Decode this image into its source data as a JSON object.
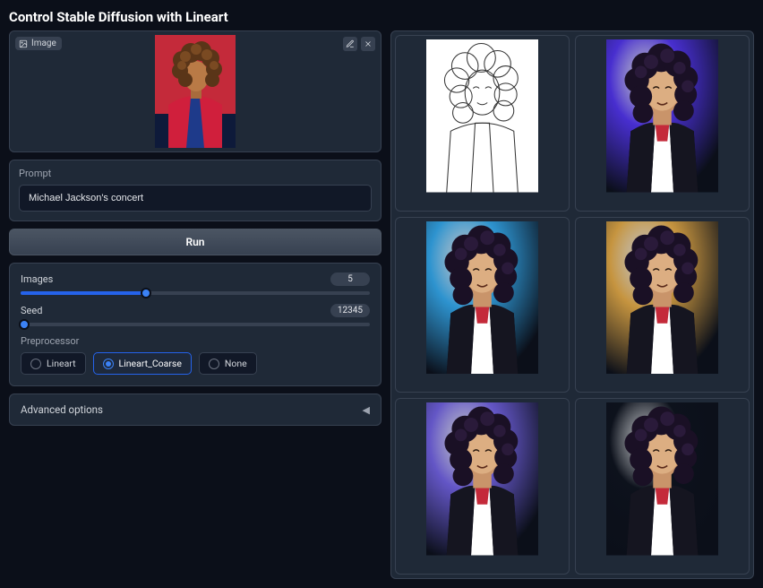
{
  "title": "Control Stable Diffusion with Lineart",
  "input_image": {
    "tag_label": "Image"
  },
  "prompt": {
    "label": "Prompt",
    "value": "Michael Jackson's concert"
  },
  "run_label": "Run",
  "sliders": {
    "images": {
      "label": "Images",
      "value": 5,
      "min": 1,
      "max": 12,
      "fill_pct": 36
    },
    "seed": {
      "label": "Seed",
      "value": 12345,
      "min": 0,
      "max": 2147483647,
      "fill_pct": 1
    }
  },
  "preprocessor": {
    "label": "Preprocessor",
    "options": [
      "Lineart",
      "Lineart_Coarse",
      "None"
    ],
    "selected": "Lineart_Coarse"
  },
  "advanced_label": "Advanced options",
  "gallery": {
    "items": [
      {
        "kind": "lineart"
      },
      {
        "kind": "render",
        "tint": "#4c2fe0"
      },
      {
        "kind": "render",
        "tint": "#2f9fe0"
      },
      {
        "kind": "render",
        "tint": "#d8a040"
      },
      {
        "kind": "render",
        "tint": "#6b5bd6"
      },
      {
        "kind": "render",
        "tint": "#0b0f19"
      }
    ]
  }
}
